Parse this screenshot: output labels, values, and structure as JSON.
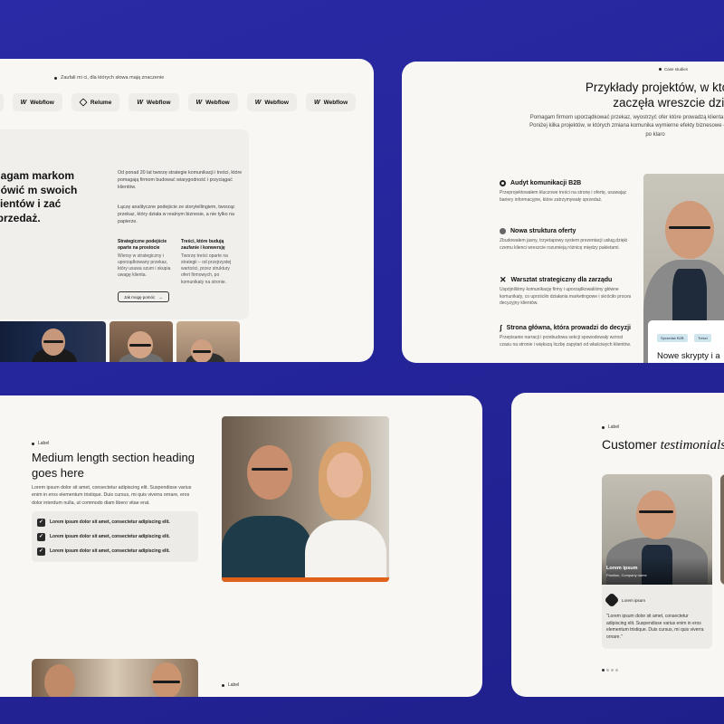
{
  "card1": {
    "trust_text": "Zaufali mi ci, dla których słowa mają znaczenie",
    "logos": [
      {
        "label": "",
        "icon": "webflow-icon"
      },
      {
        "label": "Webflow",
        "icon": "webflow-icon"
      },
      {
        "label": "Relume",
        "icon": "relume-icon"
      },
      {
        "label": "Webflow",
        "icon": "webflow-icon"
      },
      {
        "label": "Webflow",
        "icon": "webflow-icon"
      },
      {
        "label": "Webflow",
        "icon": "webflow-icon"
      },
      {
        "label": "Webflow",
        "icon": "webflow-icon"
      }
    ],
    "heading": "magam markom mówić m swoich klientów i zać sprzedaż.",
    "para1": "Od ponad 20 lat tworzę strategie komunikacji i treści, które pomagają firmom budować wiarygodność i przyciągać klientów.",
    "para2": "Łączę analityczne podejście ze storytellingiem, tworząc przekaz, który działa w realnym biznesie, a nie tylko na papierze.",
    "sub1_title": "Strategiczne podejście oparte na prostocie",
    "sub1_text": "Wiersy w strategiczny i uporządkowany przekaz, który usuwa szum i skupia uwagę klienta.",
    "sub2_title": "Treści, które budują zaufanie i konwersję",
    "sub2_text": "Tworzę treści oparte na strategii – od przejrzystej wartości, przez struktury ofert firmowych, po komunikaty na stronie.",
    "button": "Jak mogę pomóc"
  },
  "card2": {
    "label": "Case studies",
    "title": "Przykłady projektów, w których k zaczęła wreszcie dział",
    "intro": "Pomagam firmom uporządkować przekaz, wyostrzyć ofer które prowadzą klienta od pierwszego zdania i Poniżej kilka projektów, w których zmiana komunika wymierne efekty biznesowe — od wyższej konwersji po klaro",
    "services": [
      {
        "title": "Audyt komunikacji B2B",
        "desc": "Przeprojektowałem kluczowe treści na stronę i ofertę, usuwając bariery informacyjne, które zatrzymywały sprzedaż."
      },
      {
        "title": "Nowa struktura oferty",
        "desc": "Zbudowałem jasny, trzyetapowy system prezentacji usług,dzięki czemu klienci wreszcie rozumieją różnicę między pakietami."
      },
      {
        "title": "Warsztat strategiczny dla zarządu",
        "desc": "Uspójniliśmy komunikację firmy i uporządkowaliśmy główne komunikaty, co uprościło działania marketingowe i skróciło proces decyzyjny klientów."
      },
      {
        "title": "Strona główna, która prowadzi do decyzji",
        "desc": "Przepisanie narracji i przebudowa sekcji spowodowały wzrost czasu na stronie i większą liczbę zapytań od właściwych klientów."
      }
    ],
    "tags": [
      "Sprzedaż B2B",
      "Treści"
    ],
    "card_title": "Nowe skrypty i a"
  },
  "card3": {
    "label": "Label",
    "heading": "Medium length section heading goes here",
    "paragraph": "Lorem ipsum dolor sit amet, consectetur adipiscing elit. Suspendisse varius enim in eros elementum tristique. Duis cursus, mi quis viverra ornare, eros dolor interdum nulla, ut commodo diam libero vitae erat.",
    "list": [
      "Lorem ipsum dolor sit amet, consectetur adipiscing elit.",
      "Lorem ipsum dolor sit amet, consectetur adipiscing elit.",
      "Lorem ipsum dolor sit amet, consectetur adipiscing elit."
    ],
    "label2": "Label"
  },
  "card4": {
    "label": "Label",
    "title_plain": "Customer",
    "title_italic": "testimonials",
    "name": "Lorem ipsum",
    "role": "Position, Company name",
    "company": "Lorem ipsum",
    "quote": "\"Lorem ipsum dolor sit amet, consectetur adipiscing elit. Suspendisse varius enim in eros elementum tristique. Duis cursus, mi quis viverra ornare.\""
  },
  "colors": {
    "background": "#24249a",
    "card": "#f8f7f3",
    "accent_orange": "#e0611a"
  }
}
